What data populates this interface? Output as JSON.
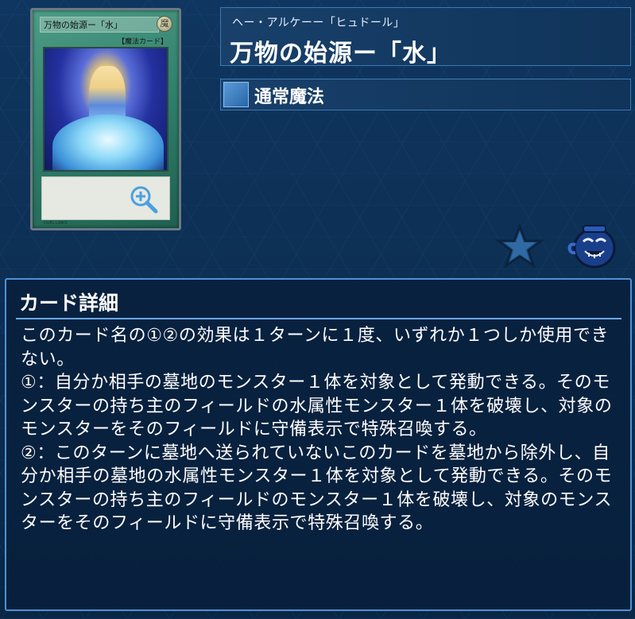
{
  "card": {
    "name_small": "万物の始源ー「水」",
    "type_small": "【魔法カード】",
    "attribute_small": "魔",
    "footer_small": "DUEL LINKS"
  },
  "header": {
    "ruby": "ヘー・アルケーー「ヒュドール」",
    "title": "万物の始源ー「水」",
    "type_label": "通常魔法"
  },
  "icons": {
    "zoom": "zoom-in-icon",
    "favorite": "star-icon",
    "pot": "pot-icon"
  },
  "details": {
    "heading": "カード詳細",
    "text": "このカード名の①②の効果は１ターンに１度、いずれか１つしか使用できない。\n①：自分か相手の墓地のモンスター１体を対象として発動できる。そのモンスターの持ち主のフィールドの水属性モンスター１体を破壊し、対象のモンスターをそのフィールドに守備表示で特殊召喚する。\n②：このターンに墓地へ送られていないこのカードを墓地から除外し、自分か相手の墓地の水属性モンスター１体を対象として発動できる。そのモンスターの持ち主のフィールドのモンスター１体を破壊し、対象のモンスターをそのフィールドに守備表示で特殊召喚する。"
  },
  "colors": {
    "background": "#0b2a4a",
    "panel_border": "#4e92d6",
    "spell_green": "#2e7c68"
  }
}
